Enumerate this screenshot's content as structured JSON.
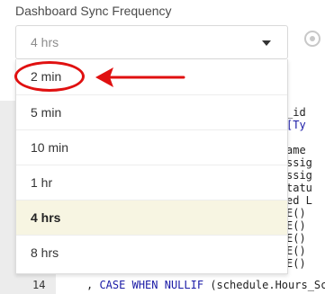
{
  "field": {
    "label": "Dashboard Sync Frequency",
    "selected_value": "4 hrs"
  },
  "menu": {
    "items": [
      {
        "label": "2 min",
        "selected": false
      },
      {
        "label": "5 min",
        "selected": false
      },
      {
        "label": "10 min",
        "selected": false
      },
      {
        "label": "1 hr",
        "selected": false
      },
      {
        "label": "4 hrs",
        "selected": true
      },
      {
        "label": "8 hrs",
        "selected": false
      }
    ]
  },
  "editor": {
    "right_fragments": [
      "_id",
      "[Ty",
      "",
      "ame",
      "ssig",
      "ssig",
      "tatu",
      "ed L",
      "E()",
      "E()",
      "E()",
      "E()",
      "E()"
    ],
    "last_line": {
      "number": "14",
      "prefix": ", ",
      "kw1": "CASE",
      "kw2": "WHEN",
      "kw3": "NULLIF",
      "rest": " (schedule.Hours_Sc"
    }
  },
  "annotation": {
    "color": "#e01010"
  },
  "icons": {
    "dropdown": "chevron-down-icon",
    "settings": "gear-icon"
  }
}
